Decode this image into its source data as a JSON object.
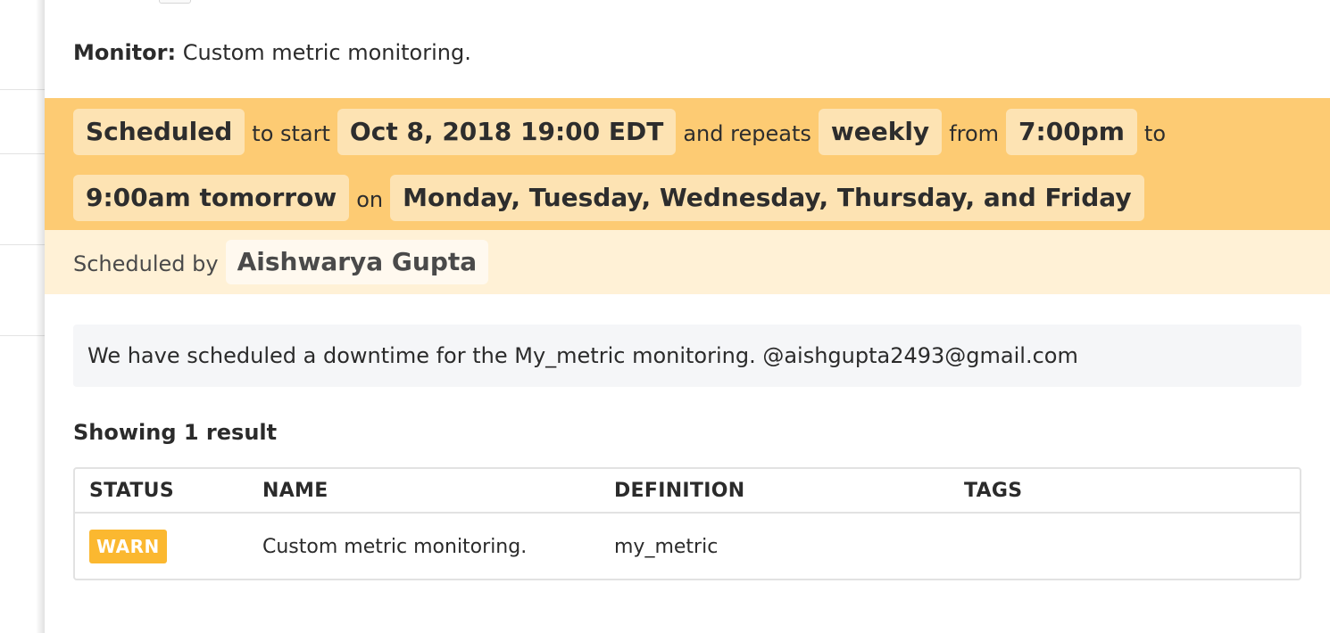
{
  "colors": {
    "schedule_band": "#fdcb73",
    "schedule_chip": "#fde3b3",
    "scheduled_by_band": "#fff1d6",
    "status_warn": "#fbb830"
  },
  "monitor": {
    "label": "Monitor:",
    "value": "Custom metric monitoring."
  },
  "schedule": {
    "state": "Scheduled",
    "to_start_text": "to start",
    "start": "Oct 8, 2018 19:00 EDT",
    "and_repeats_text": "and repeats",
    "frequency": "weekly",
    "from_text": "from",
    "from_time": "7:00pm",
    "to_text": "to",
    "to_time": "9:00am tomorrow",
    "on_text": "on",
    "days": "Monday, Tuesday, Wednesday, Thursday, and Friday"
  },
  "scheduled_by": {
    "label": "Scheduled by",
    "name": "Aishwarya Gupta"
  },
  "message": "We have scheduled a downtime for the My_metric monitoring. @aishgupta2493@gmail.com",
  "results": {
    "heading": "Showing 1 result",
    "columns": [
      "STATUS",
      "NAME",
      "DEFINITION",
      "TAGS"
    ],
    "rows": [
      {
        "status": "WARN",
        "name": "Custom metric monitoring.",
        "definition": "my_metric",
        "tags": ""
      }
    ]
  }
}
